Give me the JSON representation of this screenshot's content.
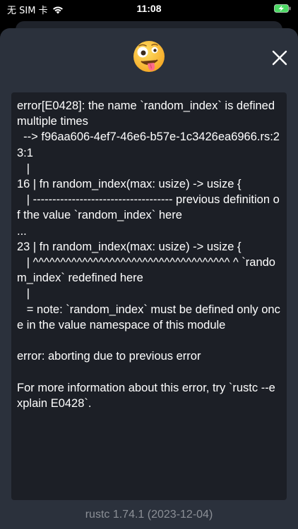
{
  "status_bar": {
    "carrier": "无 SIM 卡",
    "time": "11:08"
  },
  "icons": {
    "emoji": "zany-face-icon",
    "close": "close-icon",
    "wifi": "wifi-icon",
    "battery": "battery-charging-icon"
  },
  "colors": {
    "sheet_background": "#2b313c",
    "code_background": "#1c1f26",
    "code_text": "#ffffff",
    "version_text": "#8b8f96"
  },
  "output": {
    "text": "error[E0428]: the name `random_index` is defined multiple times\n  --> f96aa606-4ef7-46e6-b57e-1c3426ea6966.rs:23:1\n   |\n16 | fn random_index(max: usize) -> usize {\n   | ------------------------------------ previous definition of the value `random_index` here\n...\n23 | fn random_index(max: usize) -> usize {\n   | ^^^^^^^^^^^^^^^^^^^^^^^^^^^^^^^^^^^^ ^ `random_index` redefined here\n   |\n   = note: `random_index` must be defined only once in the value namespace of this module\n\nerror: aborting due to previous error\n\nFor more information about this error, try `rustc --explain E0428`."
  },
  "footer": {
    "version": "rustc 1.74.1 (2023-12-04)"
  }
}
